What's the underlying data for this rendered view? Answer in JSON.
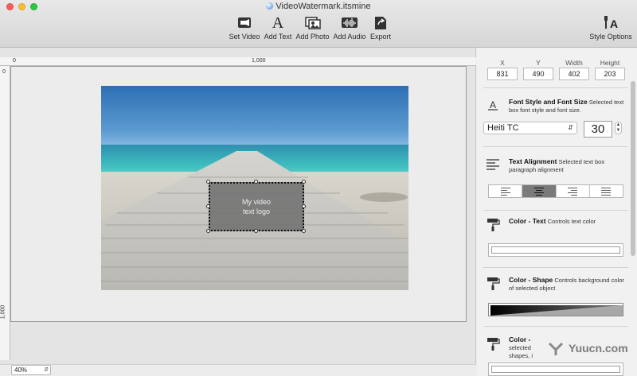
{
  "window": {
    "title": "VideoWatermark.itsmine"
  },
  "toolbar": {
    "set_video": "Set Video",
    "add_text": "Add Text",
    "add_photo": "Add Photo",
    "add_audio": "Add Audio",
    "export": "Export",
    "style_options": "Style Options"
  },
  "ruler": {
    "top_start": "0",
    "top_mid": "1,000",
    "left_start": "0",
    "left_mid": "1,000"
  },
  "canvas": {
    "text_box_line1": "My video",
    "text_box_line2": "text logo"
  },
  "zoom": {
    "value": "40%"
  },
  "inspector": {
    "coords": {
      "x_label": "X",
      "x_value": "831",
      "y_label": "Y",
      "y_value": "490",
      "w_label": "Width",
      "w_value": "402",
      "h_label": "Height",
      "h_value": "203"
    },
    "font_style": {
      "title": "Font Style and Font Size",
      "desc": "Selected text box font style and font size.",
      "font": "Heiti TC",
      "size": "30"
    },
    "alignment": {
      "title": "Text Alignment",
      "desc": "Selected text box paragraph alignment"
    },
    "color_text": {
      "title": "Color - Text",
      "desc": "Controls text color"
    },
    "color_shape": {
      "title": "Color - Shape",
      "desc": "Controls background color of selected object"
    },
    "color_other": {
      "title": "Color -",
      "desc_line1": "selected",
      "desc_line2": "shapes, i"
    }
  },
  "watermark": {
    "text": "Yuucn.com"
  }
}
